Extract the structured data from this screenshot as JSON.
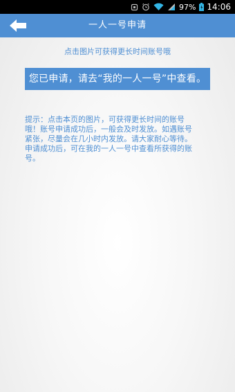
{
  "status_bar": {
    "battery": "97%",
    "time": "14:06",
    "icons": [
      "notification-icon",
      "alarm-icon",
      "wifi-icon",
      "signal-icon",
      "battery-icon"
    ]
  },
  "header": {
    "back_icon": "back-arrow-icon",
    "title": "一人一号申请"
  },
  "main": {
    "hint": "点击图片可获得更长时间账号哦",
    "notice": "您已申请，请去“我的一人一号”中查看。",
    "tip": "提示：点击本页的图片，可获得更长时间的账号哦！账号申请成功后，一般会及时发放。如遇账号紧张，尽量会在几小时内发放。请大家耐心等待。申请成功后，可在我的一人一号中查看所获得的账号。"
  },
  "colors": {
    "accent": "#4f8fd3",
    "status_bar": "#000000",
    "text_on_accent": "#ffffff"
  }
}
